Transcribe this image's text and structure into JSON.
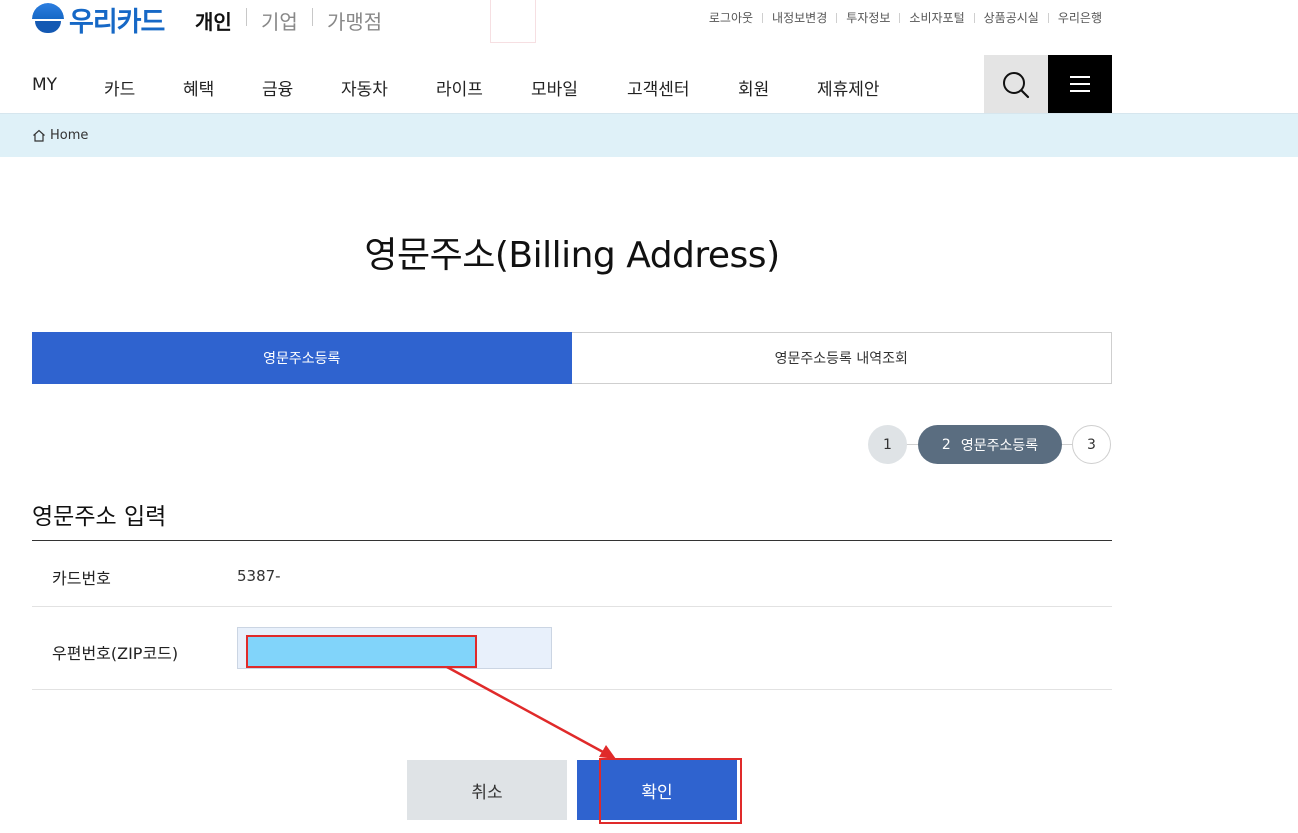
{
  "header": {
    "logo_text": "우리카드",
    "segments": [
      "개인",
      "기업",
      "가맹점"
    ],
    "utility_links": [
      "로그아웃",
      "내정보변경",
      "투자정보",
      "소비자포털",
      "상품공시실",
      "우리은행"
    ]
  },
  "gnb": {
    "items": [
      "MY",
      "카드",
      "혜택",
      "금융",
      "자동차",
      "라이프",
      "모바일",
      "고객센터",
      "회원",
      "제휴제안"
    ]
  },
  "breadcrumb": {
    "home": "Home"
  },
  "page": {
    "title": "영문주소(Billing Address)"
  },
  "tabs": [
    {
      "label": "영문주소등록",
      "active": true
    },
    {
      "label": "영문주소등록 내역조회",
      "active": false
    }
  ],
  "steps": {
    "step1": "1",
    "step2_number": "2",
    "step2_label": "영문주소등록",
    "step3": "3"
  },
  "form": {
    "section_title": "영문주소 입력",
    "card_number_label": "카드번호",
    "card_number_value": "5387-",
    "zip_label": "우편번호(ZIP코드)",
    "zip_value": ""
  },
  "buttons": {
    "cancel": "취소",
    "confirm": "확인"
  },
  "colors": {
    "brand": "#1668c6",
    "primary": "#2f63cf",
    "step_active": "#5a6d80",
    "breadcrumb_bg": "#dff1f8",
    "annotation_red": "#e02a2a",
    "zip_fill": "#81d4fa"
  }
}
